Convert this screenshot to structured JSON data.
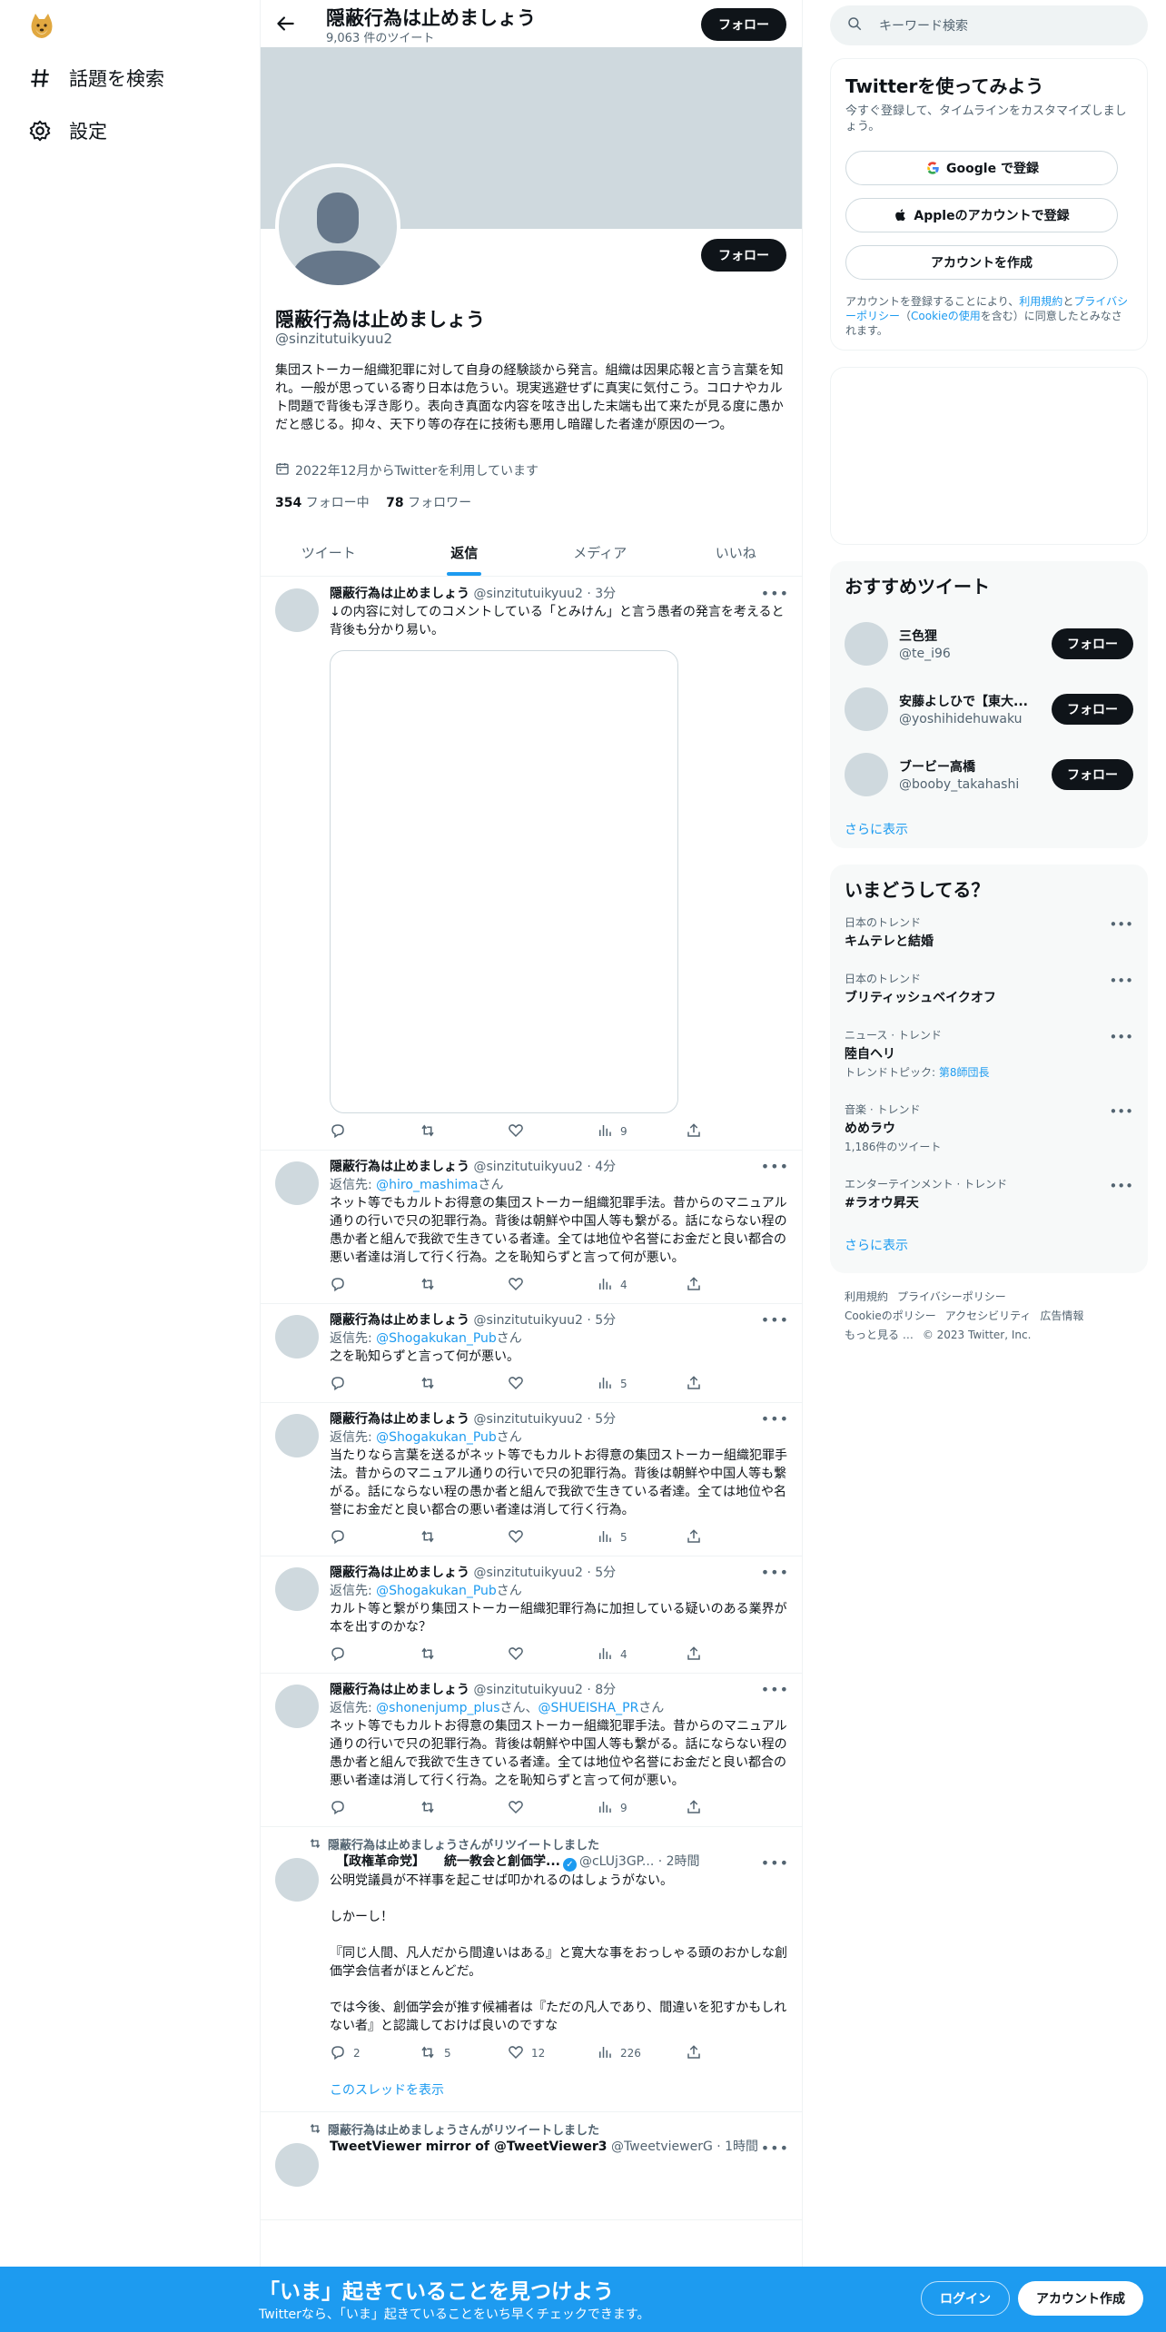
{
  "colors": {
    "accent": "#1d9bf0",
    "dark": "#0f1419",
    "muted": "#536471",
    "banner": "#cfd9de"
  },
  "nav": {
    "logo_icon": "doge-logo-icon",
    "items": [
      {
        "icon": "hashtag-icon",
        "label": "話題を検索"
      },
      {
        "icon": "gear-icon",
        "label": "設定"
      }
    ]
  },
  "header": {
    "title": "隠蔽行為は止めましょう",
    "subtitle": "9,063 件のツイート",
    "follow_label": "フォロー"
  },
  "profile": {
    "name": "隠蔽行為は止めましょう",
    "handle": "@sinzitutuikyuu2",
    "bio": "集団ストーカー組織犯罪に対して自身の経験談から発言。組織は因果応報と言う言葉を知れ。一般が思っている寄り日本は危うい。現実逃避せずに真実に気付こう。コロナやカルト問題で背後も浮き彫り。表向き真面な内容を呟き出した末端も出て来たが見る度に愚かだと感じる。抑々、天下り等の存在に技術も悪用し暗躍した者達が原因の一つ。",
    "joined": "2022年12月からTwitterを利用しています",
    "following_count": "354",
    "following_label": " フォロー中",
    "followers_count": "78",
    "followers_label": " フォロワー",
    "follow_label": "フォロー"
  },
  "tabs": [
    {
      "label": "ツイート",
      "active": false
    },
    {
      "label": "返信",
      "active": true
    },
    {
      "label": "メディア",
      "active": false
    },
    {
      "label": "いいね",
      "active": false
    }
  ],
  "tweets": [
    {
      "name": "隠蔽行為は止めましょう",
      "handle": "@sinzitutuikyuu2",
      "time": " · 3分",
      "text": "↓の内容に対してのコメントしている「とみけん」と言う愚者の発言を考えると背後も分かり易い。",
      "views": "9"
    },
    {
      "name": "隠蔽行為は止めましょう",
      "handle": "@sinzitutuikyuu2",
      "time": " · 4分",
      "reply_prefix": "返信先: ",
      "reply_to": "@hiro_mashima",
      "reply_suffix": "さん",
      "text": "ネット等でもカルトお得意の集団ストーカー組織犯罪手法。昔からのマニュアル通りの行いで只の犯罪行為。背後は朝鮮や中国人等も繋がる。話にならない程の愚か者と組んで我欲で生きている者達。全ては地位や名誉にお金だと良い都合の悪い者達は消して行く行為。之を恥知らずと言って何が悪い。",
      "views": "4"
    },
    {
      "name": "隠蔽行為は止めましょう",
      "handle": "@sinzitutuikyuu2",
      "time": " · 5分",
      "reply_prefix": "返信先: ",
      "reply_to": "@Shogakukan_Pub",
      "reply_suffix": "さん",
      "text": "之を恥知らずと言って何が悪い。",
      "views": "5"
    },
    {
      "name": "隠蔽行為は止めましょう",
      "handle": "@sinzitutuikyuu2",
      "time": " · 5分",
      "reply_prefix": "返信先: ",
      "reply_to": "@Shogakukan_Pub",
      "reply_suffix": "さん",
      "text": "当たりなら言葉を送るがネット等でもカルトお得意の集団ストーカー組織犯罪手法。昔からのマニュアル通りの行いで只の犯罪行為。背後は朝鮮や中国人等も繋がる。話にならない程の愚か者と組んで我欲で生きている者達。全ては地位や名誉にお金だと良い都合の悪い者達は消して行く行為。",
      "views": "5"
    },
    {
      "name": "隠蔽行為は止めましょう",
      "handle": "@sinzitutuikyuu2",
      "time": " · 5分",
      "reply_prefix": "返信先: ",
      "reply_to": "@Shogakukan_Pub",
      "reply_suffix": "さん",
      "text": "カルト等と繋がり集団ストーカー組織犯罪行為に加担している疑いのある業界が本を出すのかな？",
      "views": "4"
    },
    {
      "name": "隠蔽行為は止めましょう",
      "handle": "@sinzitutuikyuu2",
      "time": " · 8分",
      "reply_prefix": "返信先: ",
      "reply_to": "@shonenjump_plus",
      "reply_mid": "さん、",
      "reply_to2": "@SHUEISHA_PR",
      "reply_suffix": "さん",
      "text": "ネット等でもカルトお得意の集団ストーカー組織犯罪手法。昔からのマニュアル通りの行いで只の犯罪行為。背後は朝鮮や中国人等も繋がる。話にならない程の愚か者と組んで我欲で生きている者達。全ては地位や名誉にお金だと良い都合の悪い者達は消して行く行為。之を恥知らずと言って何が悪い。",
      "views": "9"
    },
    {
      "retweet_label": "隠蔽行為は止めましょうさんがリツイートしました",
      "name": "　【政権革命党】　　統一教会と創価学...",
      "handle": "@cLUj3GP...",
      "time": " · 2時間",
      "text": "公明党議員が不祥事を起こせば叩かれるのはしょうがない。\n\nしかーし！\n\n『同じ人間、凡人だから間違いはある』と寛大な事をおっしゃる頭のおかしな創価学会信者がほとんどだ。\n\nでは今後、創価学会が推す候補者は『ただの凡人であり、間違いを犯すかもしれない者』と認識しておけば良いのですな",
      "replies": "2",
      "retweets": "5",
      "likes": "12",
      "views": "226",
      "show_thread": "このスレッドを表示"
    },
    {
      "retweet_label": "隠蔽行為は止めましょうさんがリツイートしました",
      "name": "TweetViewer mirror of @TweetViewer3",
      "handle": "@TweetviewerG",
      "time": " · 1時間"
    }
  ],
  "right": {
    "search_placeholder": "キーワード検索",
    "signup_panel": {
      "title": "Twitterを使ってみよう",
      "subtitle": "今すぐ登録して、タイムラインをカスタマイズしましょう。",
      "google": "Google で登録",
      "apple": "Appleのアカウントで登録",
      "create": "アカウントを作成",
      "legal_1": "アカウントを登録することにより、",
      "legal_link1": "利用規約",
      "legal_2": "と",
      "legal_link2": "プライバシーポリシー",
      "legal_3": "（",
      "legal_link3": "Cookieの使用",
      "legal_4": "を含む）に同意したとみなされます。"
    },
    "who_to_follow": {
      "title": "おすすめツイート",
      "users": [
        {
          "name": "三色狸",
          "handle": "@te_i96",
          "button": "フォロー"
        },
        {
          "name": "安藤よしひで【東大...",
          "handle": "@yoshihidehuwaku",
          "button": "フォロー"
        },
        {
          "name": "ブービー高橋",
          "handle": "@booby_takahashi",
          "button": "フォロー"
        }
      ],
      "show_more": "さらに表示"
    },
    "trends": {
      "title": "いまどうしてる？",
      "items": [
        {
          "context": "日本のトレンド",
          "title": "キムテレと結婚"
        },
        {
          "context": "日本のトレンド",
          "title": "ブリティッシュベイクオフ"
        },
        {
          "context": "ニュース · トレンド",
          "title": "陸自ヘリ",
          "meta": "トレンドトピック: ",
          "meta_link": "第8師団長"
        },
        {
          "context": "音楽 · トレンド",
          "title": "めめラウ",
          "meta": "1,186件のツイート"
        },
        {
          "context": "エンターテインメント · トレンド",
          "title": "#ラオウ昇天"
        }
      ],
      "show_more": "さらに表示"
    },
    "footer": [
      "利用規約",
      "プライバシーポリシー",
      "Cookieのポリシー",
      "アクセシビリティ",
      "広告情報",
      "もっと見る …",
      "© 2023 Twitter, Inc."
    ]
  },
  "bottom_bar": {
    "title": "「いま」起きていることを見つけよう",
    "subtitle": "Twitterなら、「いま」起きていることをいち早くチェックできます。",
    "login": "ログイン",
    "signup": "アカウント作成"
  }
}
